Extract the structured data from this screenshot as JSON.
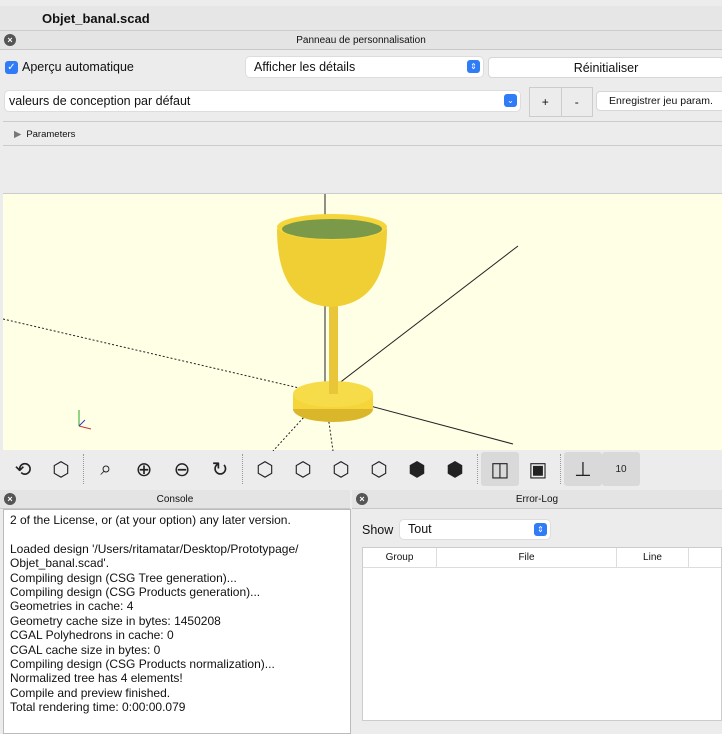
{
  "window": {
    "title": "Objet_banal.scad"
  },
  "customizer": {
    "title": "Panneau de personnalisation",
    "auto_preview_label": "Aperçu automatique",
    "auto_preview_checked": true,
    "details_select": "Afficher les détails",
    "reset_label": "Réinitialiser",
    "preset_select": "valeurs de conception par défaut",
    "add_label": "+",
    "remove_label": "-",
    "save_preset_label": "Enregistrer jeu param.",
    "parameters_label": "Parameters"
  },
  "viewport": {
    "background": "#ffffe5",
    "model_color": "#f5d53a"
  },
  "toolbar": {
    "icons": [
      "preview-icon",
      "render-icon",
      "view-all-icon",
      "zoom-in-icon",
      "zoom-out-icon",
      "reset-view-icon",
      "view-right-icon",
      "view-top-icon",
      "view-bottom-icon",
      "view-left-icon",
      "view-front-icon",
      "view-back-icon",
      "perspective-icon",
      "orthogonal-icon",
      "show-axes-icon",
      "show-scale-icon"
    ],
    "scale_label": "10"
  },
  "console": {
    "title": "Console",
    "lines": [
      "2 of the License, or (at your option) any later version.",
      "",
      "Loaded design '/Users/ritamatar/Desktop/Prototypage/",
      "Objet_banal.scad'.",
      "Compiling design (CSG Tree generation)...",
      "Compiling design (CSG Products generation)...",
      "Geometries in cache: 4",
      "Geometry cache size in bytes: 1450208",
      "CGAL Polyhedrons in cache: 0",
      "CGAL cache size in bytes: 0",
      "Compiling design (CSG Products normalization)...",
      "Normalized tree has 4 elements!",
      "Compile and preview finished.",
      "Total rendering time: 0:00:00.079"
    ]
  },
  "errorlog": {
    "title": "Error-Log",
    "show_label": "Show",
    "show_select": "Tout",
    "columns": [
      "Group",
      "File",
      "Line"
    ]
  }
}
